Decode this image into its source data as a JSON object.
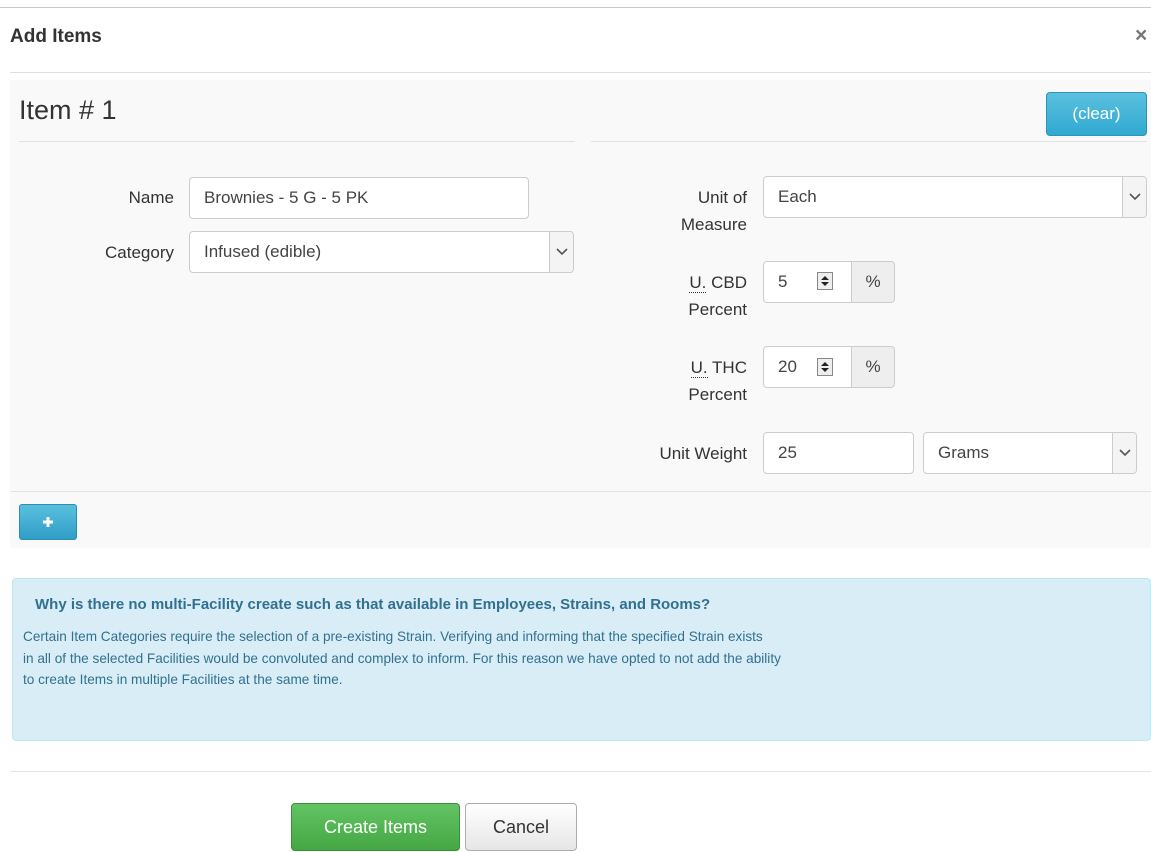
{
  "modal": {
    "title": "Add Items",
    "close_label": "×"
  },
  "item": {
    "heading": "Item # 1",
    "clear_label": "(clear)"
  },
  "form": {
    "name_label": "Name",
    "name_value": "Brownies - 5 G - 5 PK",
    "category_label": "Category",
    "category_value": "Infused (edible)",
    "uom_label_line1": "Unit of",
    "uom_label_line2": "Measure",
    "uom_value": "Each",
    "cbd_abbr": "U.",
    "cbd_label_rest": "CBD",
    "cbd_label_line2": "Percent",
    "cbd_value": "5",
    "cbd_unit": "%",
    "thc_abbr": "U.",
    "thc_label_rest": "THC",
    "thc_label_line2": "Percent",
    "thc_value": "20",
    "thc_unit": "%",
    "weight_label": "Unit Weight",
    "weight_value": "25",
    "weight_unit_value": "Grams"
  },
  "add_icon": "plus-icon",
  "info": {
    "title": "Why is there no multi-Facility create such as that available in Employees, Strains, and Rooms?",
    "line1": "Certain Item Categories require the selection of a pre-existing Strain. Verifying and informing that the specified Strain exists",
    "line2": "in all of the selected Facilities would be convoluted and complex to inform. For this reason we have opted to not add the ability",
    "line3": "to create Items in multiple Facilities at the same time."
  },
  "footer": {
    "create_label": "Create Items",
    "cancel_label": "Cancel"
  },
  "colors": {
    "info_accent": "#31708f",
    "primary_info": "#5bc0de",
    "success": "#5cb85c"
  }
}
